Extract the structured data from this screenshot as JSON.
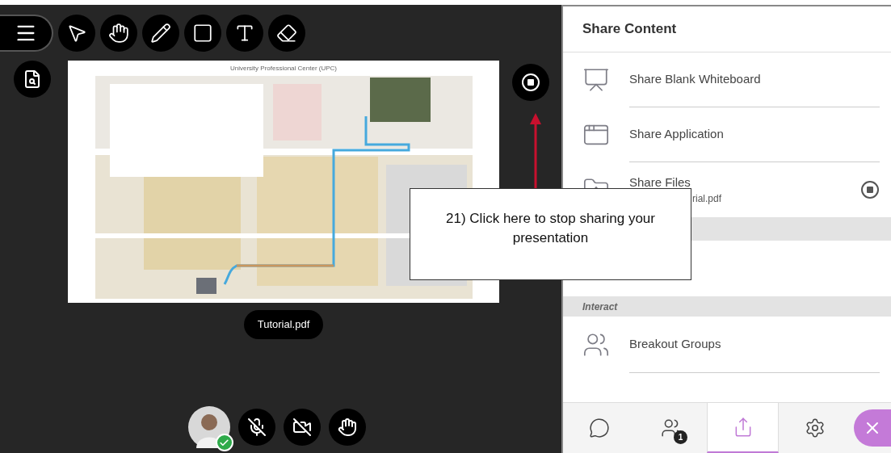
{
  "toolbar": [
    {
      "kind": "menu"
    },
    {
      "kind": "pointer"
    },
    {
      "kind": "pan"
    },
    {
      "kind": "pen"
    },
    {
      "kind": "shape"
    },
    {
      "kind": "text"
    },
    {
      "kind": "eraser"
    }
  ],
  "slide": {
    "title": "University Professional Center (UPC)",
    "file_name": "Tutorial.pdf",
    "sharing": true
  },
  "callout": {
    "text": "21) Click here to stop sharing your presentation"
  },
  "panel": {
    "title": "Share Content",
    "items": [
      {
        "kind": "whiteboard",
        "label": "Share Blank Whiteboard"
      },
      {
        "kind": "application",
        "label": "Share Application"
      },
      {
        "kind": "files",
        "label": "Share Files",
        "subtitle": "rial.pdf",
        "sharing": true
      }
    ],
    "section": "Interact",
    "interact_items": [
      {
        "kind": "breakout",
        "label": "Breakout Groups"
      }
    ]
  },
  "me": {
    "available": true
  },
  "media_controls": [
    {
      "kind": "mic",
      "off": true
    },
    {
      "kind": "camera",
      "off": true
    },
    {
      "kind": "hand",
      "off": false
    }
  ],
  "tabs": [
    {
      "kind": "chat",
      "selected": false
    },
    {
      "kind": "participants",
      "selected": false,
      "badge": "1"
    },
    {
      "kind": "share",
      "selected": true
    },
    {
      "kind": "settings",
      "selected": false
    }
  ]
}
